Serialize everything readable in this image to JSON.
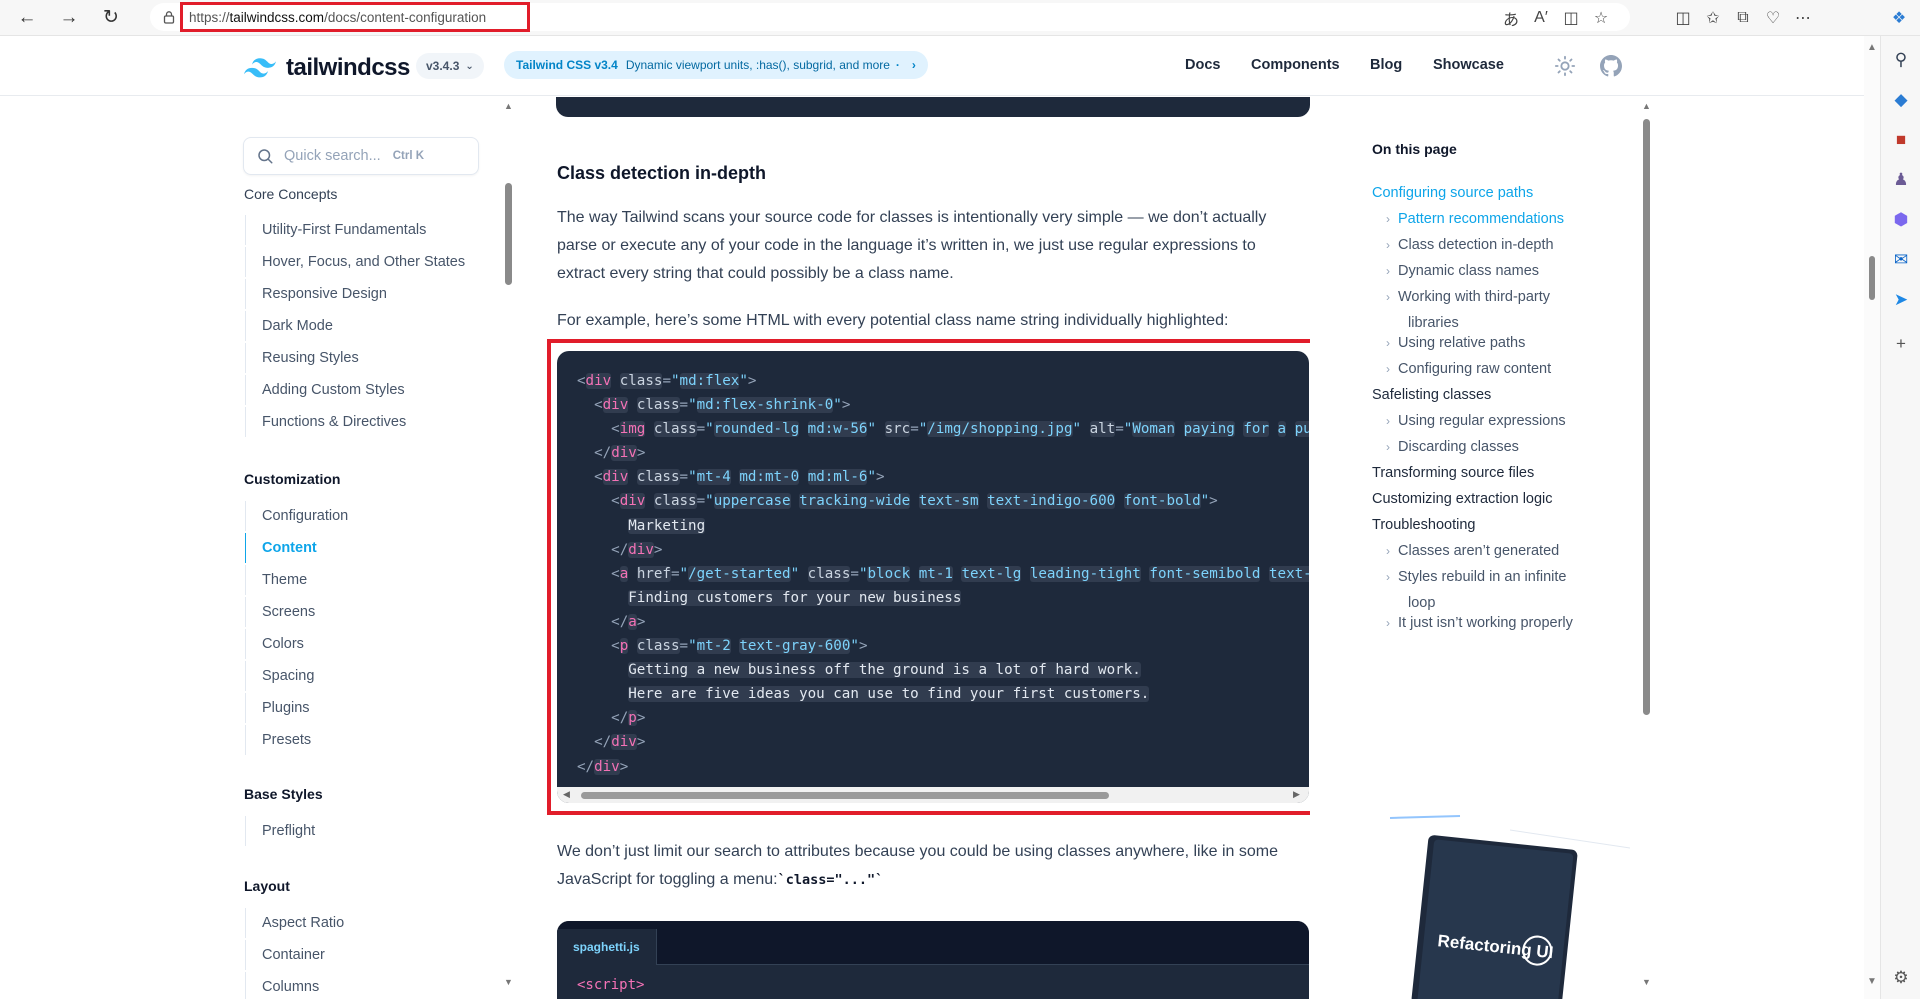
{
  "browser": {
    "url_prefix": "https://",
    "url_domain": "tailwindcss.com",
    "url_path": "/docs/content-configuration"
  },
  "topnav": {
    "logo_text": "tailwindcss",
    "version": "v3.4.3",
    "announce_title": "Tailwind CSS v3.4",
    "announce_text": "Dynamic viewport units, :has(), subgrid, and more",
    "links": [
      "Docs",
      "Components",
      "Blog",
      "Showcase"
    ]
  },
  "sidebar": {
    "search_placeholder": "Quick search...",
    "search_shortcut": "Ctrl K",
    "sections": [
      {
        "title": "Core Concepts",
        "items": [
          "Utility-First Fundamentals",
          "Hover, Focus, and Other States",
          "Responsive Design",
          "Dark Mode",
          "Reusing Styles",
          "Adding Custom Styles",
          "Functions & Directives"
        ]
      },
      {
        "title": "Customization",
        "items": [
          "Configuration",
          "Content",
          "Theme",
          "Screens",
          "Colors",
          "Spacing",
          "Plugins",
          "Presets"
        ]
      },
      {
        "title": "Base Styles",
        "items": [
          "Preflight"
        ]
      },
      {
        "title": "Layout",
        "items": [
          "Aspect Ratio",
          "Container",
          "Columns"
        ]
      }
    ],
    "active_item": "Content"
  },
  "main": {
    "heading": "Class detection in-depth",
    "para1": "The way Tailwind scans your source code for classes is intentionally very simple — we don’t actually parse or execute any of your code in the language it’s written in, we just use regular expressions to extract every string that could possibly be a class name.",
    "para2": "For example, here’s some HTML with every potential class name string individually highlighted:",
    "para3_text": "We don’t just limit our search to attributes because you could be using classes anywhere, like in some JavaScript for toggling a menu:",
    "para3_code": "`class=\"...\"`",
    "code_text": {
      "marketing": "Marketing",
      "finding": "Finding customers for your new business",
      "getting": "Getting a new business off the ground is a lot of hard work.",
      "here": "Here are five ideas you can use to find your first customers."
    },
    "js_tab": "spaghetti.js",
    "js_first_line": "<script>"
  },
  "toc": {
    "title": "On this page",
    "items": [
      {
        "label": "Configuring source paths",
        "level": 1,
        "active": true
      },
      {
        "label": "Pattern recommendations",
        "level": 2,
        "active": true
      },
      {
        "label": "Class detection in-depth",
        "level": 2
      },
      {
        "label": "Dynamic class names",
        "level": 2
      },
      {
        "label": "Working with third-party",
        "level": 2
      },
      {
        "label": "libraries",
        "level": 2,
        "continuation": true
      },
      {
        "label": "Using relative paths",
        "level": 2
      },
      {
        "label": "Configuring raw content",
        "level": 2
      },
      {
        "label": "Safelisting classes",
        "level": 1
      },
      {
        "label": "Using regular expressions",
        "level": 2
      },
      {
        "label": "Discarding classes",
        "level": 2
      },
      {
        "label": "Transforming source files",
        "level": 1
      },
      {
        "label": "Customizing extraction logic",
        "level": 1
      },
      {
        "label": "Troubleshooting",
        "level": 1
      },
      {
        "label": "Classes aren’t generated",
        "level": 2
      },
      {
        "label": "Styles rebuild in an infinite",
        "level": 2
      },
      {
        "label": "loop",
        "level": 2,
        "continuation": true
      },
      {
        "label": "It just isn’t working properly",
        "level": 2
      }
    ],
    "ad_title": "Refactoring UI"
  },
  "colors": {
    "accent": "#0ea5e9",
    "highlight_box": "#e11d2a",
    "code_bg": "#1e293b"
  }
}
